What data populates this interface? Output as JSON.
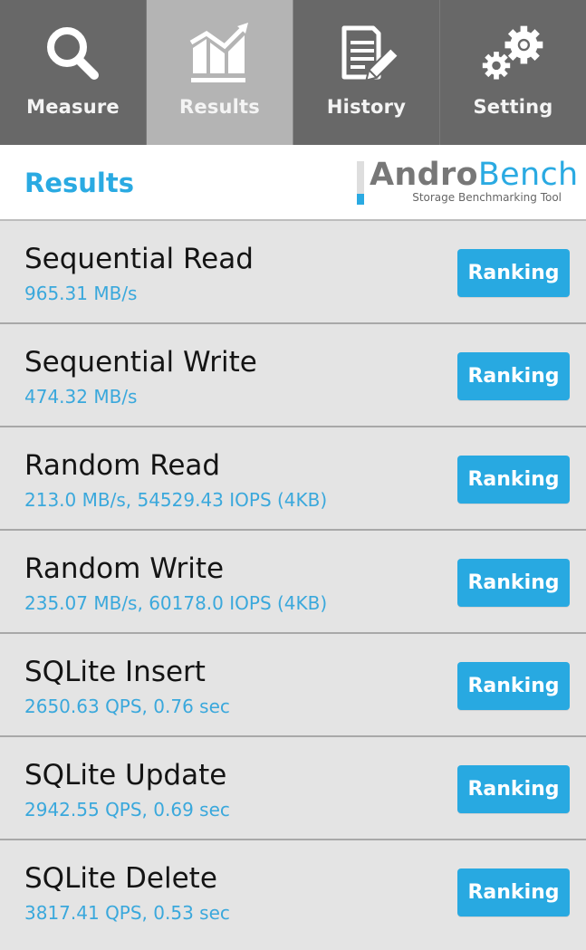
{
  "tabs": [
    {
      "label": "Measure",
      "icon": "magnifier-icon",
      "active": false
    },
    {
      "label": "Results",
      "icon": "chart-icon",
      "active": true
    },
    {
      "label": "History",
      "icon": "document-pencil-icon",
      "active": false
    },
    {
      "label": "Setting",
      "icon": "gears-icon",
      "active": false
    }
  ],
  "header": {
    "title": "Results",
    "logo": {
      "andro": "Andro",
      "bench": "Bench",
      "tagline": "Storage Benchmarking Tool"
    }
  },
  "results": [
    {
      "name": "Sequential Read",
      "value": "965.31 MB/s",
      "button": "Ranking"
    },
    {
      "name": "Sequential Write",
      "value": "474.32 MB/s",
      "button": "Ranking"
    },
    {
      "name": "Random Read",
      "value": "213.0 MB/s, 54529.43 IOPS (4KB)",
      "button": "Ranking"
    },
    {
      "name": "Random Write",
      "value": "235.07 MB/s, 60178.0 IOPS (4KB)",
      "button": "Ranking"
    },
    {
      "name": "SQLite Insert",
      "value": "2650.63 QPS, 0.76 sec",
      "button": "Ranking"
    },
    {
      "name": "SQLite Update",
      "value": "2942.55 QPS, 0.69 sec",
      "button": "Ranking"
    },
    {
      "name": "SQLite Delete",
      "value": "3817.41 QPS, 0.53 sec",
      "button": "Ranking"
    }
  ],
  "colors": {
    "accent": "#2aaae2",
    "tabbar": "#686868",
    "tab_active": "#b4b4b4",
    "list_bg": "#e4e4e4"
  }
}
